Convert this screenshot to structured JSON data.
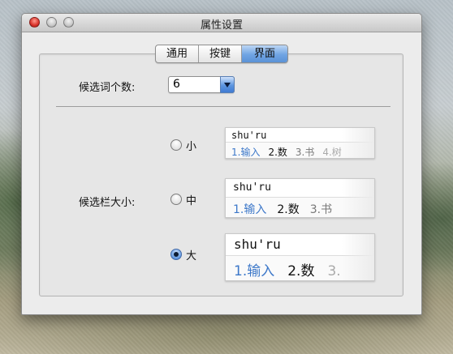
{
  "window": {
    "title": "属性设置"
  },
  "tabs": [
    {
      "label": "通用",
      "selected": false
    },
    {
      "label": "按键",
      "selected": false
    },
    {
      "label": "界面",
      "selected": true
    }
  ],
  "candidate_count": {
    "label": "候选词个数:",
    "value": "6"
  },
  "candidate_bar_size": {
    "label": "候选栏大小:",
    "options": [
      {
        "label": "小",
        "checked": false
      },
      {
        "label": "中",
        "checked": false
      },
      {
        "label": "大",
        "checked": true
      }
    ]
  },
  "previews": {
    "small": {
      "pinyin": "shu'ru",
      "candidates": [
        "1.输入",
        "2.数",
        "3.书",
        "4.树"
      ]
    },
    "medium": {
      "pinyin": "shu'ru",
      "candidates": [
        "1.输入",
        "2.数",
        "3.书"
      ]
    },
    "large": {
      "pinyin": "shu'ru",
      "candidates": [
        "1.输入",
        "2.数",
        "3."
      ]
    }
  },
  "colors": {
    "selected_tab": "#6fa4e3",
    "first_candidate": "#3d78c9",
    "close_button": "#d8322a"
  }
}
